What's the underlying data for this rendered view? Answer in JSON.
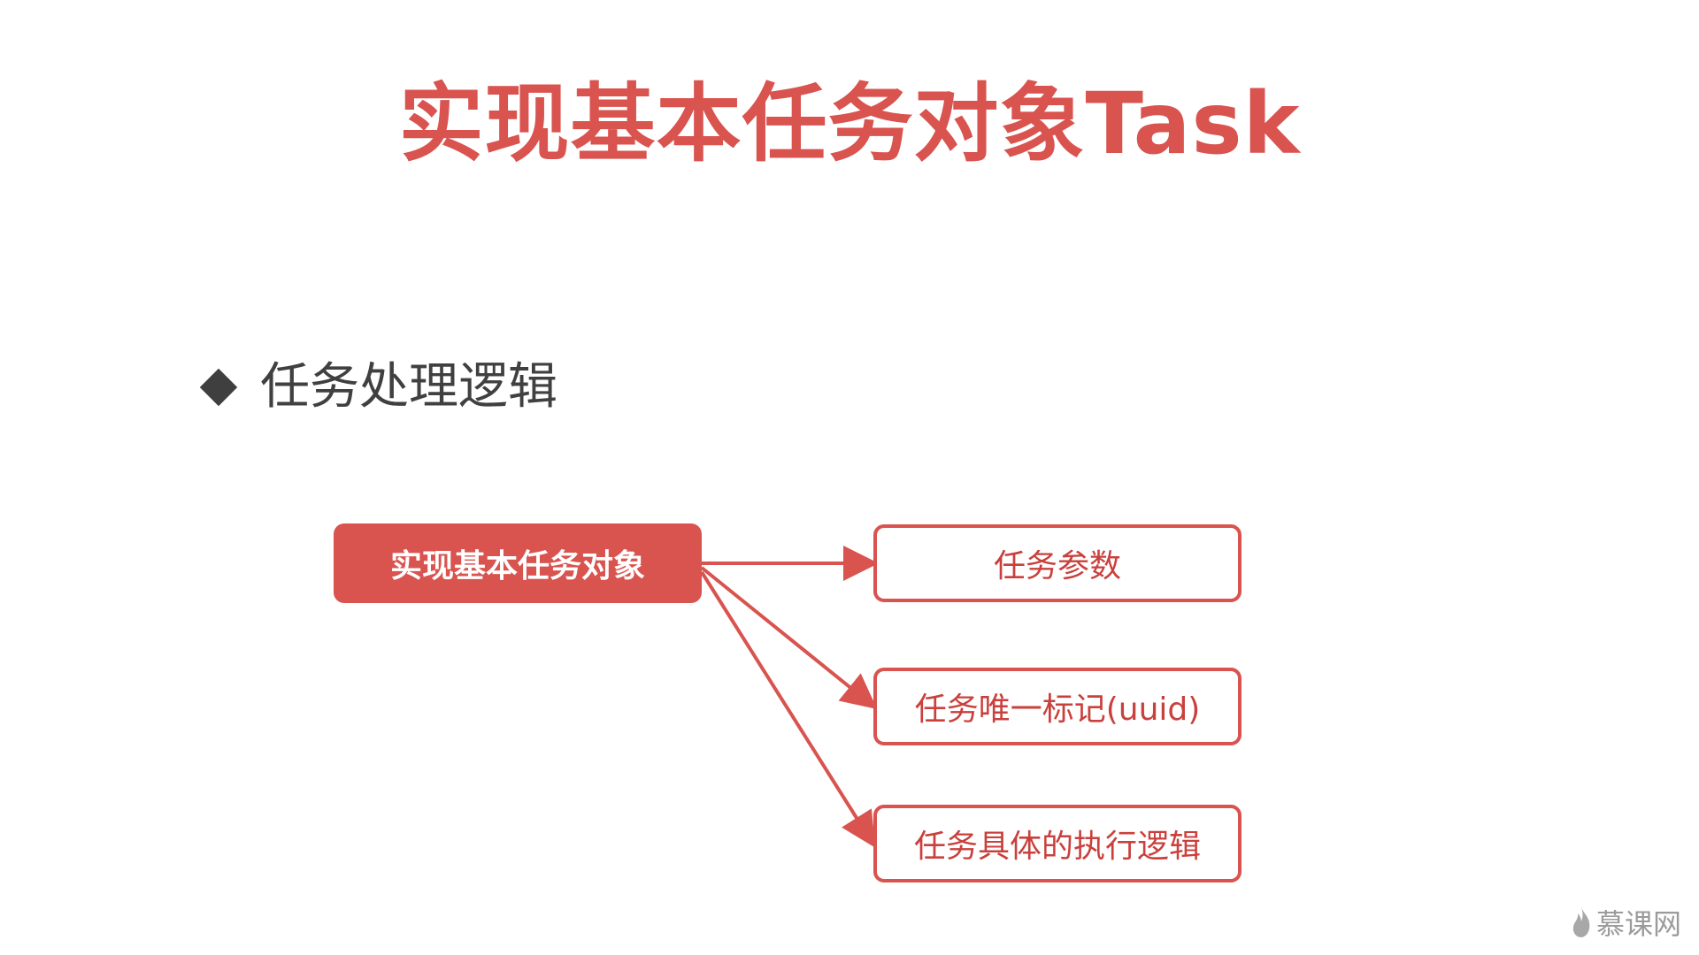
{
  "title": "实现基本任务对象Task",
  "bullet": {
    "text": "任务处理逻辑"
  },
  "diagram": {
    "source": "实现基本任务对象",
    "targets": [
      "任务参数",
      "任务唯一标记(uuid)",
      "任务具体的执行逻辑"
    ]
  },
  "colors": {
    "accent": "#d9534f",
    "text_dark": "#404040"
  },
  "watermark": {
    "text": "慕课网"
  }
}
